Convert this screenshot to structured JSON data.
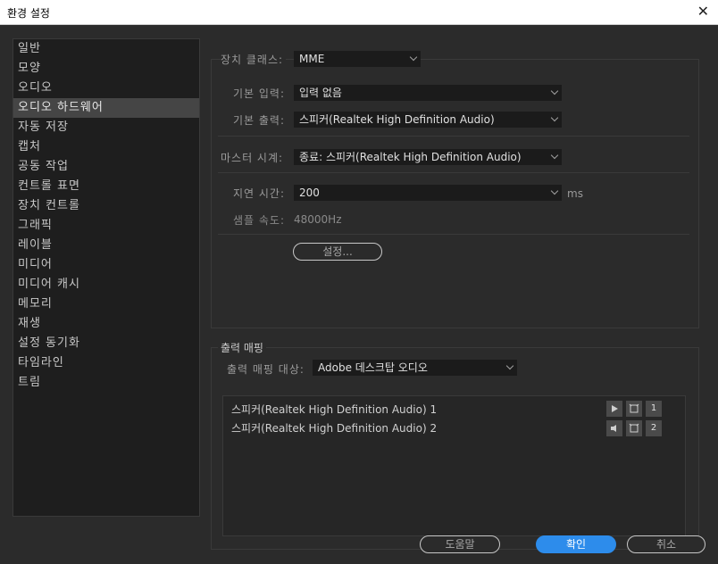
{
  "window": {
    "title": "환경 설정",
    "close": "✕"
  },
  "sidebar": {
    "items": [
      {
        "label": "일반"
      },
      {
        "label": "모양"
      },
      {
        "label": "오디오"
      },
      {
        "label": "오디오 하드웨어"
      },
      {
        "label": "자동 저장"
      },
      {
        "label": "캡처"
      },
      {
        "label": "공동 작업"
      },
      {
        "label": "컨트롤 표면"
      },
      {
        "label": "장치 컨트롤"
      },
      {
        "label": "그래픽"
      },
      {
        "label": "레이블"
      },
      {
        "label": "미디어"
      },
      {
        "label": "미디어 캐시"
      },
      {
        "label": "메모리"
      },
      {
        "label": "재생"
      },
      {
        "label": "설정 동기화"
      },
      {
        "label": "타임라인"
      },
      {
        "label": "트림"
      }
    ],
    "selected": "오디오 하드웨어"
  },
  "hardware": {
    "device_class_label": "장치 클래스:",
    "device_class_value": "MME",
    "default_input_label": "기본 입력:",
    "default_input_value": "입력 없음",
    "default_output_label": "기본 출력:",
    "default_output_value": "스피커(Realtek High Definition Audio)",
    "master_clock_label": "마스터 시계:",
    "master_clock_value": "종료: 스피커(Realtek High Definition Audio)",
    "latency_label": "지연 시간:",
    "latency_value": "200",
    "latency_unit": "ms",
    "sample_rate_label": "샘플 속도:",
    "sample_rate_value": "48000Hz",
    "settings_button": "설정..."
  },
  "output_mapping": {
    "section_label": "출력 매핑",
    "target_label": "출력 매핑 대상:",
    "target_value": "Adobe 데스크탑 오디오",
    "channels": [
      {
        "label": "스피커(Realtek High Definition Audio) 1",
        "number": "1"
      },
      {
        "label": "스피커(Realtek High Definition Audio) 2",
        "number": "2"
      }
    ]
  },
  "footer": {
    "help": "도움말",
    "ok": "확인",
    "cancel": "취소"
  },
  "colors": {
    "background": "#2b2b2b",
    "sidebar_bg": "#1e1e1e",
    "selected_bg": "#454545",
    "accent": "#2d8ceb"
  }
}
